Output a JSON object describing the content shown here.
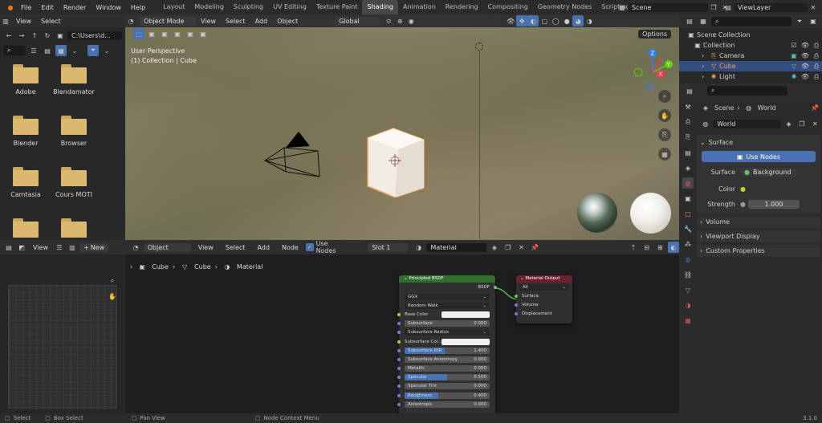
{
  "topbar": {
    "menus": [
      "File",
      "Edit",
      "Render",
      "Window",
      "Help"
    ],
    "workspaces": [
      "Layout",
      "Modeling",
      "Sculpting",
      "UV Editing",
      "Texture Paint",
      "Shading",
      "Animation",
      "Rendering",
      "Compositing",
      "Geometry Nodes",
      "Scripting"
    ],
    "active_workspace": "Shading",
    "scene": "Scene",
    "view_layer": "ViewLayer"
  },
  "file_browser": {
    "menus": [
      "View",
      "Select"
    ],
    "path": "C:\\Users\\d...",
    "folders": [
      "Adobe",
      "Blendamator",
      "Blender",
      "Browser",
      "Camtasia",
      "Cours MOTI",
      "",
      ""
    ]
  },
  "viewport": {
    "mode": "Object Mode",
    "menus": [
      "View",
      "Select",
      "Add",
      "Object"
    ],
    "orientation": "Global",
    "options": "Options",
    "overlay_line1": "User Perspective",
    "overlay_line2": "(1) Collection | Cube",
    "axes": {
      "x": "X",
      "y": "Y",
      "z": "Z"
    }
  },
  "image_editor": {
    "view_label": "View",
    "new_label": "New"
  },
  "node_editor": {
    "editor_type": "Object",
    "menus": [
      "View",
      "Select",
      "Add",
      "Node"
    ],
    "use_nodes": "Use Nodes",
    "slot": "Slot 1",
    "material": "Material",
    "breadcrumb": [
      "Cube",
      "Cube",
      "Material"
    ]
  },
  "principled": {
    "title": "Principled BSDF",
    "output": "BSDF",
    "distribution": "GGX",
    "subsurface_method": "Random Walk",
    "rows": [
      {
        "label": "Base Color",
        "value": "",
        "type": "color",
        "socket": "y"
      },
      {
        "label": "Subsurface",
        "value": "0.000",
        "type": "num",
        "socket": "g",
        "fill": 0
      },
      {
        "label": "Subsurface Radius",
        "value": "",
        "type": "drop",
        "socket": "g"
      },
      {
        "label": "Subsurface Col...",
        "value": "",
        "type": "color",
        "socket": "y"
      },
      {
        "label": "Subsurface IOR",
        "value": "1.400",
        "type": "num",
        "socket": "g",
        "fill": 0.47
      },
      {
        "label": "Subsurface Anisotropy",
        "value": "0.000",
        "type": "num",
        "socket": "g",
        "fill": 0
      },
      {
        "label": "Metallic",
        "value": "0.000",
        "type": "num",
        "socket": "g",
        "fill": 0
      },
      {
        "label": "Specular",
        "value": "0.500",
        "type": "num",
        "socket": "g",
        "fill": 0.5
      },
      {
        "label": "Specular Tint",
        "value": "0.000",
        "type": "num",
        "socket": "g",
        "fill": 0
      },
      {
        "label": "Roughness",
        "value": "0.400",
        "type": "num",
        "socket": "g",
        "fill": 0.4
      },
      {
        "label": "Anisotropic",
        "value": "0.000",
        "type": "num",
        "socket": "g",
        "fill": 0
      }
    ]
  },
  "material_output": {
    "title": "Material Output",
    "target": "All",
    "sockets": [
      "Surface",
      "Volume",
      "Displacement"
    ]
  },
  "outliner": {
    "root": "Scene Collection",
    "collection": "Collection",
    "items": [
      "Camera",
      "Cube",
      "Light"
    ]
  },
  "properties": {
    "context_scene": "Scene",
    "context_world": "World",
    "world_name": "World",
    "surface_panel": "Surface",
    "use_nodes": "Use Nodes",
    "surface_label": "Surface",
    "surface_value": "Background",
    "color_label": "Color",
    "strength_label": "Strength",
    "strength_value": "1.000",
    "panels": [
      "Volume",
      "Viewport Display",
      "Custom Properties"
    ]
  },
  "statusbar": {
    "items": [
      "Select",
      "Box Select",
      "Pan View",
      "Node Context Menu"
    ],
    "version": "3.1.0"
  }
}
